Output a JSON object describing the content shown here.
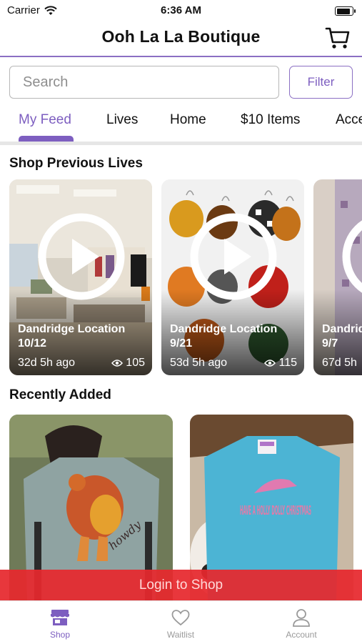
{
  "status_bar": {
    "carrier": "Carrier",
    "time": "6:36 AM",
    "battery_level": 0.9
  },
  "header": {
    "title": "Ooh La La Boutique",
    "cart_icon": "cart-icon"
  },
  "search": {
    "placeholder": "Search",
    "value": ""
  },
  "filter": {
    "label": "Filter"
  },
  "tabs": [
    {
      "label": "My Feed",
      "active": true
    },
    {
      "label": "Lives"
    },
    {
      "label": "Home"
    },
    {
      "label": "$10 Items"
    },
    {
      "label": "Acce"
    }
  ],
  "sections": {
    "previous_lives": "Shop Previous Lives",
    "recently_added": "Recently Added"
  },
  "lives": [
    {
      "name": "Dandridge Location",
      "date": "10/12",
      "ago": "32d 5h ago",
      "views": "105"
    },
    {
      "name": "Dandridge Location",
      "date": "9/21",
      "ago": "53d 5h ago",
      "views": "115"
    },
    {
      "name": "Dandrid",
      "date": "9/7",
      "ago": "67d 5h"
    }
  ],
  "recent_items": [
    {
      "print": "howdy"
    },
    {
      "print": "HAVE A HOLLY DOLLY CHRISTMAS"
    }
  ],
  "login_bar": {
    "label": "Login to Shop"
  },
  "bottom_nav": [
    {
      "label": "Shop",
      "icon": "store-icon",
      "active": true
    },
    {
      "label": "Waitlist",
      "icon": "heart-icon"
    },
    {
      "label": "Account",
      "icon": "person-icon"
    }
  ],
  "colors": {
    "accent": "#7d5ec0",
    "login_bar": "#e6282d"
  }
}
